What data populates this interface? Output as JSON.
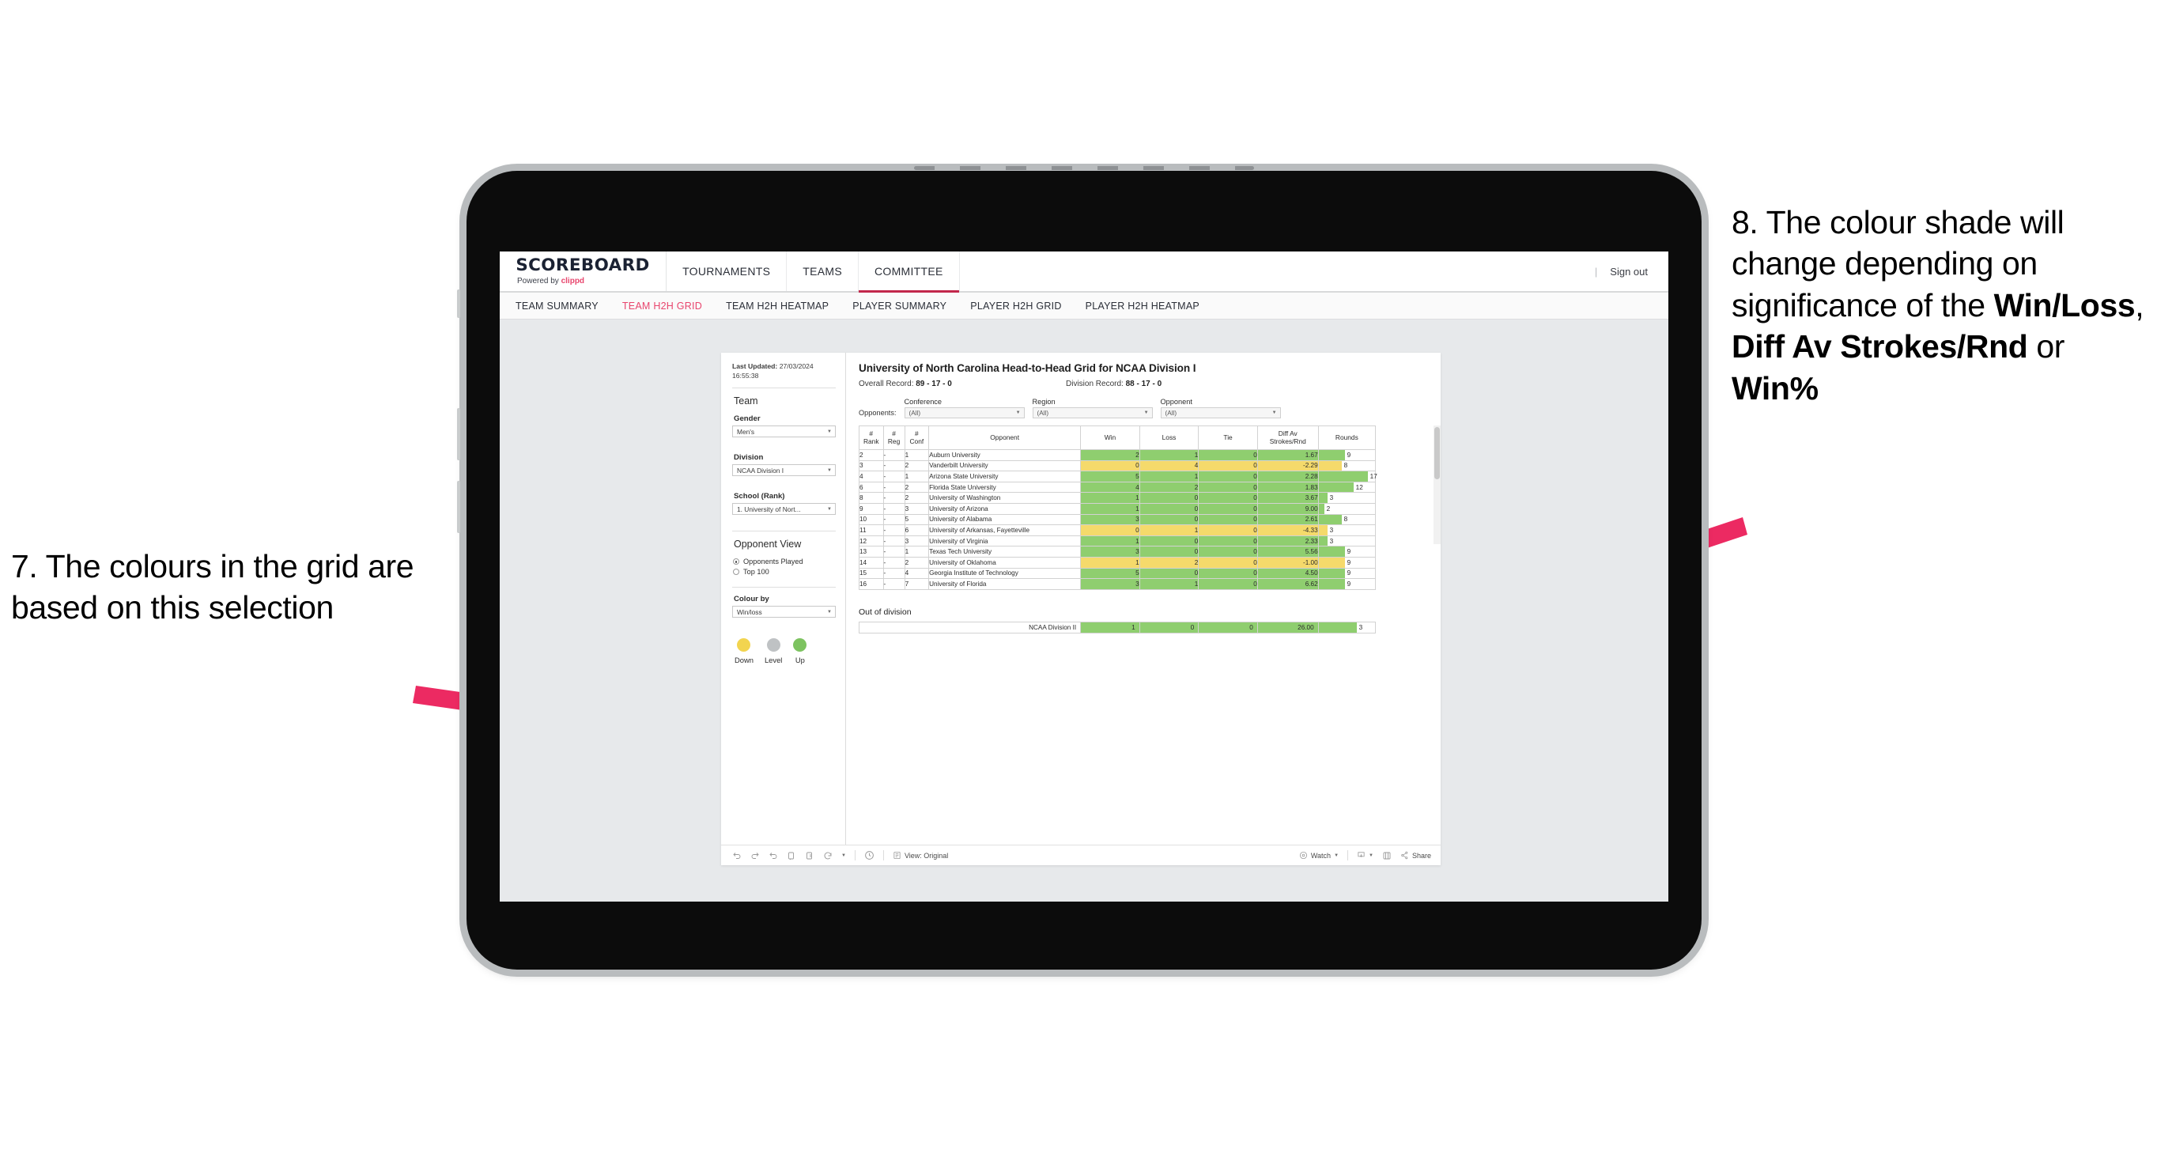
{
  "annotations": {
    "left": "7. The colours in the grid are based on this selection",
    "right_pre": "8. The colour shade will change depending on significance of the ",
    "right_b1": "Win/Loss",
    "right_mid1": ", ",
    "right_b2": "Diff Av Strokes/Rnd",
    "right_mid2": " or ",
    "right_b3": "Win%",
    "arrow_color": "#ec2a62"
  },
  "header": {
    "brand_title": "SCOREBOARD",
    "brand_sub_prefix": "Powered by ",
    "brand_sub_accent": "clippd",
    "nav": [
      {
        "label": "TOURNAMENTS",
        "active": false
      },
      {
        "label": "TEAMS",
        "active": false
      },
      {
        "label": "COMMITTEE",
        "active": true
      }
    ],
    "divider": "|",
    "signout": "Sign out",
    "accent": "#c2274b"
  },
  "subnav": {
    "items": [
      {
        "label": "TEAM SUMMARY",
        "active": false
      },
      {
        "label": "TEAM H2H GRID",
        "active": true
      },
      {
        "label": "TEAM H2H HEATMAP",
        "active": false
      },
      {
        "label": "PLAYER SUMMARY",
        "active": false
      },
      {
        "label": "PLAYER H2H GRID",
        "active": false
      },
      {
        "label": "PLAYER H2H HEATMAP",
        "active": false
      }
    ],
    "active_color": "#e8456d"
  },
  "filters": {
    "last_updated_label": "Last Updated: ",
    "last_updated_value": "27/03/2024 16:55:38",
    "team_heading": "Team",
    "gender_label": "Gender",
    "gender_value": "Men's",
    "division_label": "Division",
    "division_value": "NCAA Division I",
    "school_label": "School (Rank)",
    "school_value": "1. University of Nort...",
    "opponent_view_heading": "Opponent View",
    "opponent_view_options": [
      {
        "label": "Opponents Played",
        "selected": true
      },
      {
        "label": "Top 100",
        "selected": false
      }
    ],
    "colour_by_label": "Colour by",
    "colour_by_value": "Win/loss",
    "legend": [
      {
        "label": "Down",
        "color": "#f2d44f"
      },
      {
        "label": "Level",
        "color": "#bfc2c4"
      },
      {
        "label": "Up",
        "color": "#7dc360"
      }
    ]
  },
  "viz": {
    "title": "University of North Carolina Head-to-Head Grid for NCAA Division I",
    "overall_record_label": "Overall Record: ",
    "overall_record_value": "89 - 17 - 0",
    "division_record_label": "Division Record: ",
    "division_record_value": "88 - 17 - 0",
    "opponents_label": "Opponents:",
    "opponent_filters": [
      {
        "label": "Conference",
        "value": "(All)"
      },
      {
        "label": "Region",
        "value": "(All)"
      },
      {
        "label": "Opponent",
        "value": "(All)"
      }
    ],
    "out_of_division_label": "Out of division"
  },
  "chart_data": {
    "type": "table",
    "title": "University of North Carolina Head-to-Head Grid for NCAA Division I",
    "columns": [
      "# Rank",
      "# Reg",
      "# Conf",
      "Opponent",
      "Win",
      "Loss",
      "Tie",
      "Diff Av Strokes/Rnd",
      "Rounds"
    ],
    "column_headers_multiline": [
      [
        "#",
        "Rank"
      ],
      [
        "#",
        "Reg"
      ],
      [
        "#",
        "Conf"
      ],
      [
        "Opponent"
      ],
      [
        "Win"
      ],
      [
        "Loss"
      ],
      [
        "Tie"
      ],
      [
        "Diff Av",
        "Strokes/Rnd"
      ],
      [
        "Rounds"
      ]
    ],
    "colour_by": "Win/loss",
    "colors": {
      "up": "#8fce6f",
      "down": "#f5da6b",
      "level": "#bfc2c4",
      "rounds_bar": "#8fce6f",
      "rounds_bar_down": "#f5da6b"
    },
    "rounds_max": 17,
    "rows": [
      {
        "rank": "2",
        "reg": "-",
        "conf": "1",
        "opponent": "Auburn University",
        "win": "2",
        "loss": "1",
        "tie": "0",
        "diff": "1.67",
        "rounds": "9",
        "state": "up"
      },
      {
        "rank": "3",
        "reg": "-",
        "conf": "2",
        "opponent": "Vanderbilt University",
        "win": "0",
        "loss": "4",
        "tie": "0",
        "diff": "-2.29",
        "rounds": "8",
        "state": "down"
      },
      {
        "rank": "4",
        "reg": "-",
        "conf": "1",
        "opponent": "Arizona State University",
        "win": "5",
        "loss": "1",
        "tie": "0",
        "diff": "2.28",
        "rounds": "17",
        "state": "up"
      },
      {
        "rank": "6",
        "reg": "-",
        "conf": "2",
        "opponent": "Florida State University",
        "win": "4",
        "loss": "2",
        "tie": "0",
        "diff": "1.83",
        "rounds": "12",
        "state": "up"
      },
      {
        "rank": "8",
        "reg": "-",
        "conf": "2",
        "opponent": "University of Washington",
        "win": "1",
        "loss": "0",
        "tie": "0",
        "diff": "3.67",
        "rounds": "3",
        "state": "up"
      },
      {
        "rank": "9",
        "reg": "-",
        "conf": "3",
        "opponent": "University of Arizona",
        "win": "1",
        "loss": "0",
        "tie": "0",
        "diff": "9.00",
        "rounds": "2",
        "state": "up"
      },
      {
        "rank": "10",
        "reg": "-",
        "conf": "5",
        "opponent": "University of Alabama",
        "win": "3",
        "loss": "0",
        "tie": "0",
        "diff": "2.61",
        "rounds": "8",
        "state": "up"
      },
      {
        "rank": "11",
        "reg": "-",
        "conf": "6",
        "opponent": "University of Arkansas, Fayetteville",
        "win": "0",
        "loss": "1",
        "tie": "0",
        "diff": "-4.33",
        "rounds": "3",
        "state": "down"
      },
      {
        "rank": "12",
        "reg": "-",
        "conf": "3",
        "opponent": "University of Virginia",
        "win": "1",
        "loss": "0",
        "tie": "0",
        "diff": "2.33",
        "rounds": "3",
        "state": "up"
      },
      {
        "rank": "13",
        "reg": "-",
        "conf": "1",
        "opponent": "Texas Tech University",
        "win": "3",
        "loss": "0",
        "tie": "0",
        "diff": "5.56",
        "rounds": "9",
        "state": "up"
      },
      {
        "rank": "14",
        "reg": "-",
        "conf": "2",
        "opponent": "University of Oklahoma",
        "win": "1",
        "loss": "2",
        "tie": "0",
        "diff": "-1.00",
        "rounds": "9",
        "state": "down"
      },
      {
        "rank": "15",
        "reg": "-",
        "conf": "4",
        "opponent": "Georgia Institute of Technology",
        "win": "5",
        "loss": "0",
        "tie": "0",
        "diff": "4.50",
        "rounds": "9",
        "state": "up"
      },
      {
        "rank": "16",
        "reg": "-",
        "conf": "7",
        "opponent": "University of Florida",
        "win": "3",
        "loss": "1",
        "tie": "0",
        "diff": "6.62",
        "rounds": "9",
        "state": "up"
      }
    ],
    "out_of_division_rows": [
      {
        "name": "NCAA Division II",
        "win": "1",
        "loss": "0",
        "tie": "0",
        "diff": "26.00",
        "rounds": "3",
        "state": "up"
      }
    ]
  },
  "toolbar": {
    "view_label": "View: Original",
    "watch_label": "Watch",
    "share_label": "Share",
    "icons": [
      "undo-icon",
      "redo-icon",
      "revert-icon",
      "refresh-icon",
      "pause-icon",
      "alerts-icon",
      "help-icon",
      "view-icon",
      "watch-icon",
      "download-icon",
      "fullscreen-icon",
      "share-icon"
    ]
  }
}
